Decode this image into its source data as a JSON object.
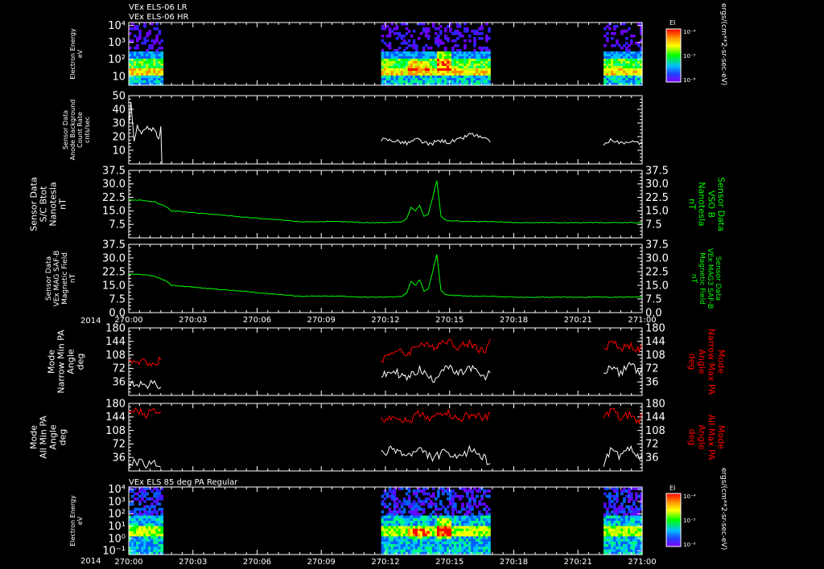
{
  "colors": {
    "background": "#000000",
    "axes": "#ffffff",
    "trace_white": "#ffffff",
    "trace_green": "#00ff00",
    "trace_red": "#ff0000"
  },
  "header": {
    "line1": "VEx ELS-06 LR",
    "line2": "VEx ELS-06 HR",
    "bottom_panel_title": "VEx ELS 85 deg PA Regular"
  },
  "colorbar": {
    "label": "EI",
    "units": "ergs/(cm**2-sr-sec-eV)",
    "ticks": [
      "10⁻⁴",
      "10⁻⁵",
      "10⁻⁶"
    ]
  },
  "x_axis": {
    "year_label": "2014",
    "tick_labels": [
      "270:00",
      "270:03",
      "270:06",
      "270:09",
      "270:12",
      "270:15",
      "270:18",
      "270:21",
      "271:00"
    ]
  },
  "chart_data": [
    {
      "type": "heatmap",
      "name": "energy_spectrogram_top",
      "ylabel": [
        "Electron Energy",
        "eV"
      ],
      "yscale": "log",
      "ylim": [
        3,
        15000
      ],
      "yticks": [
        "10⁴",
        "10³",
        "10²",
        "10"
      ],
      "data_time_ranges": [
        [
          0.0,
          1.6
        ],
        [
          11.8,
          16.9
        ],
        [
          22.2,
          24.0
        ]
      ]
    },
    {
      "type": "line",
      "name": "anode_background",
      "ylabel": [
        "Sensor Data",
        "Anode Background",
        "Count Rate",
        "cnts/sec"
      ],
      "ylim": [
        0,
        50
      ],
      "yticks": [
        "50",
        "40",
        "30",
        "20",
        "10"
      ],
      "series": [
        {
          "name": "",
          "color": "white",
          "x": [
            0.0,
            0.1,
            0.25,
            0.4,
            0.6,
            0.8,
            1.0,
            1.2,
            1.4,
            1.5,
            1.55
          ],
          "y": [
            28,
            46,
            16,
            28,
            22,
            27,
            25,
            26,
            18,
            27,
            0
          ]
        },
        {
          "name": "",
          "color": "white",
          "x": [
            11.8,
            12.5,
            13.0,
            13.5,
            14.0,
            14.5,
            15.0,
            15.5,
            16.0,
            16.5,
            16.9
          ],
          "y": [
            18,
            17,
            15,
            18,
            14,
            17,
            16,
            18,
            22,
            19,
            16
          ]
        },
        {
          "name": "",
          "color": "white",
          "x": [
            22.2,
            22.6,
            23.0,
            23.4,
            23.8,
            24.0
          ],
          "y": [
            14,
            18,
            15,
            17,
            15,
            16
          ]
        }
      ]
    },
    {
      "type": "line",
      "name": "b_vso",
      "ylabel_left": [
        "Sensor Data",
        "S/C Btot",
        "Nanotesla",
        "nT"
      ],
      "ylabel_right": [
        "Sensor Data",
        "VSO B",
        "Nanotesla",
        "nT"
      ],
      "ylim": [
        0,
        37.5
      ],
      "yticks": [
        "37.5",
        "30.0",
        "22.5",
        "15.0",
        "7.5"
      ],
      "series": [
        {
          "name": "",
          "color": "green",
          "x": [
            0,
            0.5,
            1.2,
            1.8,
            2.0,
            3.0,
            4.0,
            5.0,
            6.0,
            7.0,
            8.0,
            9.0,
            10.0,
            11.0,
            12.0,
            12.8,
            13.0,
            13.2,
            13.4,
            13.6,
            13.8,
            14.0,
            14.2,
            14.4,
            14.6,
            14.8,
            15.0,
            16.0,
            17.0,
            18.0,
            19.0,
            20.0,
            21.0,
            22.0,
            23.0,
            24.0
          ],
          "y": [
            21,
            21,
            20,
            17,
            15,
            14,
            13,
            12,
            11,
            10,
            9,
            9,
            9,
            8.5,
            8.5,
            9,
            11,
            17,
            15,
            18,
            12,
            13,
            22,
            32,
            12,
            10,
            9.5,
            9,
            9,
            8.5,
            8.5,
            8.5,
            8.5,
            8.5,
            8.5,
            8.5
          ]
        }
      ]
    },
    {
      "type": "line",
      "name": "mag3_b",
      "ylabel_left": [
        "Sensor Data",
        "VEx MAG SAF-B",
        "Magnetic Field",
        "nT"
      ],
      "ylabel_right": [
        "Sensor Data",
        "VEx MAG3 SAF-B",
        "Magnetic Field",
        "nT"
      ],
      "ylim": [
        0,
        37.5
      ],
      "yticks": [
        "37.5",
        "30.0",
        "22.5",
        "15.0",
        "7.5",
        "0.0"
      ],
      "series": [
        {
          "name": "",
          "color": "green",
          "x": [
            0,
            0.5,
            1.2,
            1.8,
            2.0,
            3.0,
            4.0,
            5.0,
            6.0,
            7.0,
            8.0,
            9.0,
            10.0,
            11.0,
            12.0,
            12.8,
            13.0,
            13.2,
            13.4,
            13.6,
            13.8,
            14.0,
            14.2,
            14.4,
            14.6,
            14.8,
            15.0,
            16.0,
            17.0,
            18.0,
            19.0,
            20.0,
            21.0,
            22.0,
            23.0,
            24.0
          ],
          "y": [
            21,
            21,
            20,
            17,
            15,
            14,
            13,
            12,
            11,
            10,
            9,
            9,
            9,
            8.5,
            8.5,
            9,
            11,
            17,
            15,
            18,
            12,
            13,
            22,
            32,
            12,
            10,
            9.5,
            9,
            9,
            8.5,
            8.5,
            8.5,
            8.5,
            8.5,
            8.5,
            8.5
          ]
        }
      ]
    },
    {
      "type": "line",
      "name": "narrow_pa",
      "ylabel_left": [
        "Mode",
        "Narrow Min PA",
        "Angle",
        "deg"
      ],
      "ylabel_right": [
        "Mode",
        "Narrow Max PA",
        "Angle",
        "deg"
      ],
      "ylim": [
        0,
        180
      ],
      "yticks": [
        "180",
        "144",
        "108",
        "72",
        "36"
      ],
      "series": [
        {
          "name": "",
          "color": "red",
          "x": [
            0,
            0.4,
            0.8,
            1.2,
            1.5,
            11.8,
            12.4,
            13.0,
            13.6,
            14.2,
            14.8,
            15.4,
            16.0,
            16.6,
            16.9,
            22.2,
            22.6,
            23.0,
            23.4,
            23.8,
            24.0
          ],
          "y": [
            95,
            85,
            92,
            80,
            95,
            95,
            120,
            110,
            140,
            125,
            150,
            130,
            140,
            115,
            150,
            115,
            150,
            125,
            135,
            120,
            130
          ]
        },
        {
          "name": "",
          "color": "white",
          "x": [
            0,
            0.4,
            0.8,
            1.2,
            1.5,
            11.8,
            12.4,
            13.0,
            13.6,
            14.2,
            14.8,
            15.4,
            16.0,
            16.6,
            16.9,
            22.2,
            22.6,
            23.0,
            23.4,
            23.8,
            24.0
          ],
          "y": [
            28,
            35,
            25,
            32,
            22,
            50,
            65,
            45,
            70,
            40,
            80,
            55,
            75,
            45,
            60,
            60,
            80,
            55,
            90,
            60,
            80
          ]
        }
      ]
    },
    {
      "type": "line",
      "name": "all_pa",
      "ylabel_left": [
        "Mode",
        "All Min PA",
        "Angle",
        "deg"
      ],
      "ylabel_right": [
        "Mode",
        "All Max PA",
        "Angle",
        "deg"
      ],
      "ylim": [
        0,
        180
      ],
      "yticks": [
        "180",
        "144",
        "108",
        "72",
        "36"
      ],
      "series": [
        {
          "name": "",
          "color": "red",
          "x": [
            0,
            0.4,
            0.8,
            1.2,
            1.5,
            11.8,
            12.4,
            13.0,
            13.6,
            14.2,
            14.8,
            15.4,
            16.0,
            16.6,
            16.9,
            22.2,
            22.6,
            23.0,
            23.4,
            23.8,
            24.0
          ],
          "y": [
            155,
            160,
            150,
            162,
            158,
            135,
            150,
            130,
            155,
            140,
            160,
            135,
            150,
            140,
            155,
            140,
            165,
            135,
            150,
            130,
            150
          ]
        },
        {
          "name": "",
          "color": "white",
          "x": [
            0,
            0.4,
            0.8,
            1.2,
            1.5,
            11.8,
            12.4,
            13.0,
            13.6,
            14.2,
            14.8,
            15.4,
            16.0,
            16.6,
            16.9,
            22.2,
            22.6,
            23.0,
            23.4,
            23.8,
            24.0
          ],
          "y": [
            20,
            25,
            15,
            22,
            10,
            45,
            60,
            40,
            55,
            35,
            50,
            30,
            60,
            35,
            20,
            20,
            65,
            35,
            60,
            40,
            45
          ]
        }
      ]
    },
    {
      "type": "heatmap",
      "name": "energy_spectrogram_85deg",
      "ylabel": [
        "Electron Energy",
        "eV"
      ],
      "yscale": "log",
      "ylim": [
        0.05,
        15000
      ],
      "yticks": [
        "10⁴",
        "10³",
        "10²",
        "10¹",
        "10⁰",
        "10⁻¹"
      ],
      "data_time_ranges": [
        [
          0.0,
          1.6
        ],
        [
          11.8,
          16.9
        ],
        [
          22.2,
          24.0
        ]
      ]
    }
  ]
}
